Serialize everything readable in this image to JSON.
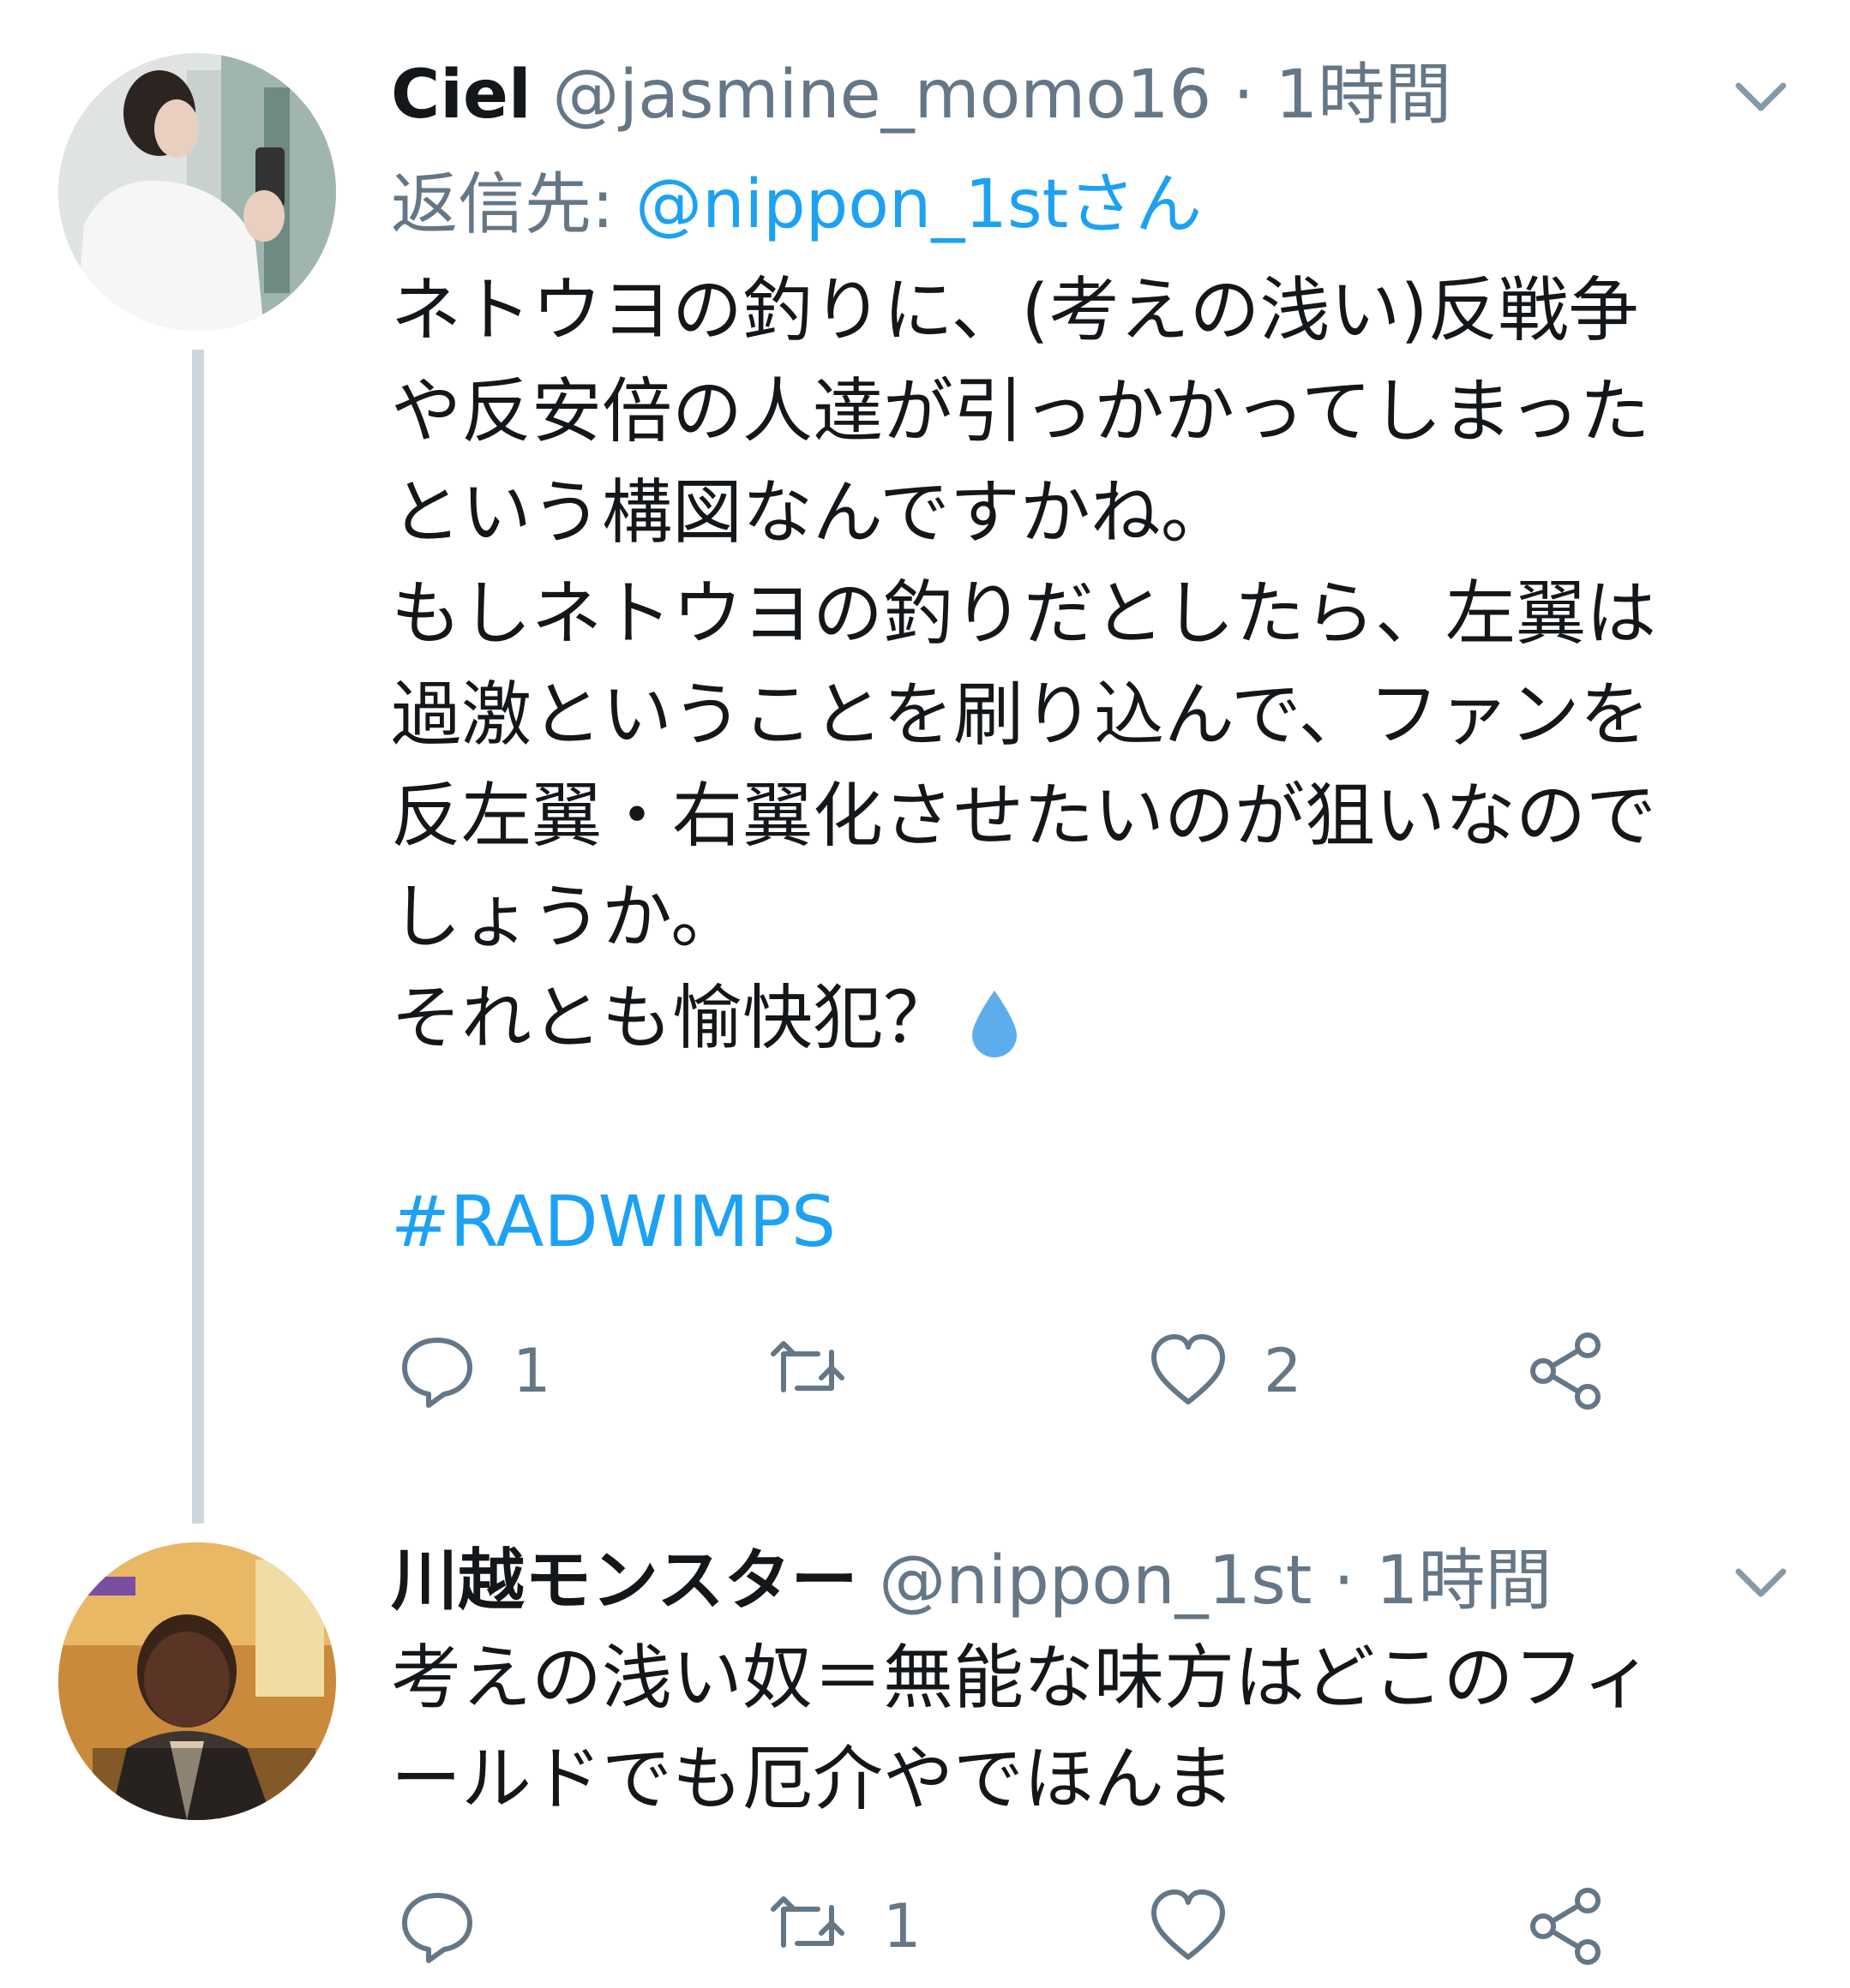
{
  "tweets": [
    {
      "name": "Ciel",
      "handle": "@jasmine_momo16",
      "separator": "·",
      "time": "1時間",
      "reply_prefix": "返信先:",
      "reply_mention": "@nippon_1stさん",
      "lines": [
        "ネトウヨの釣りに、(考えの浅い)反戦争",
        "や反安倍の人達が引っかかってしまった",
        "という構図なんですかね。",
        "もしネトウヨの釣りだとしたら、左翼は",
        "過激ということを刷り込んで、ファンを",
        "反左翼・右翼化させたいのが狙いなので",
        "しょうか。",
        "それとも愉快犯？"
      ],
      "hashtag": "#RADWIMPS",
      "reply_count": "1",
      "retweet_count": "",
      "like_count": "2"
    },
    {
      "name": "川越モンスター",
      "handle": "@nippon_1st",
      "separator": "·",
      "time": "1時間",
      "lines": [
        "考えの浅い奴＝無能な味方はどこのフィ",
        "ールドでも厄介やでほんま"
      ],
      "reply_count": "",
      "retweet_count": "1",
      "like_count": ""
    }
  ],
  "icons": {
    "caret": "chevron-down-icon",
    "reply": "reply-icon",
    "retweet": "retweet-icon",
    "like": "heart-icon",
    "share": "share-icon",
    "emoji": "droplet-icon"
  },
  "colors": {
    "text": "#14171a",
    "secondary": "#657786",
    "link": "#1da1f2",
    "thread_line": "#ccd6dd",
    "droplet": "#5dadec"
  }
}
